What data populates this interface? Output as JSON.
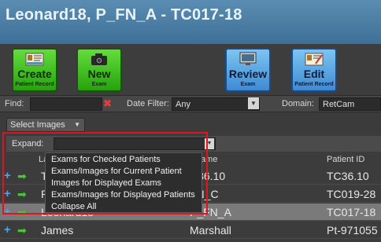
{
  "window": {
    "title": "Leonard18, P_FN_A - TC017-18"
  },
  "toolbar": {
    "create": {
      "label": "Create",
      "sub": "Patient Record",
      "icon": "patient-record-icon"
    },
    "new": {
      "label": "New",
      "sub": "Exam",
      "icon": "camera-icon"
    },
    "review": {
      "label": "Review",
      "sub": "Exam",
      "icon": "monitor-icon"
    },
    "edit": {
      "label": "Edit",
      "sub": "Patient Record",
      "icon": "edit-record-icon"
    }
  },
  "findbar": {
    "find_label": "Find:",
    "find_value": "",
    "date_filter_label": "Date Filter:",
    "date_filter_value": "Any",
    "domain_label": "Domain:",
    "domain_value": "RetCam"
  },
  "select_images": {
    "label": "Select Images"
  },
  "expand": {
    "label": "Expand:",
    "value": ""
  },
  "table": {
    "headers": {
      "last": "Las",
      "first": "t Name",
      "id": "Patient ID"
    },
    "rows": [
      {
        "last": "TC",
        "first": "C36.10",
        "id": "TC36.10",
        "selected": false
      },
      {
        "last": "Pc",
        "first": "FN_C",
        "id": "TC019-28",
        "selected": false
      },
      {
        "last": "Leonard18",
        "first": "P_FN_A",
        "id": "TC017-18",
        "selected": true
      },
      {
        "last": "James",
        "first": "Marshall",
        "id": "Pt-971055",
        "selected": false
      }
    ]
  },
  "expand_menu": [
    "Exams for Checked Patients",
    "Exams/Images for Current Patient",
    "Images for Displayed Exams",
    "Exams/Images for Displayed Patients",
    "Collapse All"
  ],
  "colors": {
    "accent_green": "#27a20e",
    "accent_blue": "#3f8ad3",
    "highlight_red": "#e0141e",
    "clear_red": "#e53c3c"
  }
}
